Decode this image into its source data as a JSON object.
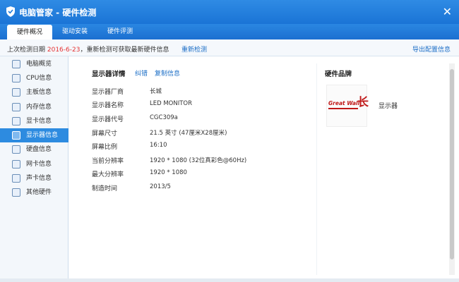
{
  "window": {
    "title": "电脑管家 - 硬件检测",
    "close_glyph": "✕"
  },
  "tabs": [
    {
      "label": "硬件概况",
      "active": true
    },
    {
      "label": "驱动安装",
      "active": false
    },
    {
      "label": "硬件评测",
      "active": false
    }
  ],
  "infobar": {
    "prefix": "上次检测日期 ",
    "date": "2016-6-23",
    "suffix": "，重新检测可获取最新硬件信息",
    "redetect": "重新检测",
    "export": "导出配置信息"
  },
  "sidebar": {
    "items": [
      {
        "label": "电脑概览",
        "icon": "monitor-icon"
      },
      {
        "label": "CPU信息",
        "icon": "cpu-icon"
      },
      {
        "label": "主板信息",
        "icon": "motherboard-icon"
      },
      {
        "label": "内存信息",
        "icon": "memory-icon"
      },
      {
        "label": "显卡信息",
        "icon": "gpu-icon"
      },
      {
        "label": "显示器信息",
        "icon": "display-icon",
        "active": true
      },
      {
        "label": "硬盘信息",
        "icon": "disk-icon"
      },
      {
        "label": "网卡信息",
        "icon": "network-icon"
      },
      {
        "label": "声卡信息",
        "icon": "sound-icon"
      },
      {
        "label": "其他硬件",
        "icon": "other-hardware-icon"
      }
    ]
  },
  "details": {
    "title": "显示器详情",
    "action_correct": "纠错",
    "action_copy": "复制信息",
    "fields": [
      {
        "key": "显示器厂商",
        "value": "长城"
      },
      {
        "key": "显示器名称",
        "value": "LED MONITOR"
      },
      {
        "key": "显示器代号",
        "value": "CGC309a"
      },
      {
        "key": "屏幕尺寸",
        "value": "21.5 英寸 (47厘米X28厘米)"
      },
      {
        "key": "屏幕比例",
        "value": "16:10"
      },
      {
        "key": "当前分辨率",
        "value": "1920 * 1080 (32位真彩色@60Hz)"
      },
      {
        "key": "最大分辨率",
        "value": "1920 * 1080"
      },
      {
        "key": "制造时间",
        "value": "2013/5"
      }
    ]
  },
  "brand": {
    "title": "硬件品牌",
    "logo_text_en": "Great Wall",
    "logo_text_cn": "长",
    "caption": "显示器",
    "accent": "#c01818"
  },
  "colors": {
    "titlebar": "#1f7cdc",
    "active_item": "#2d8be0",
    "link": "#1a6dc6",
    "date": "#e53333"
  }
}
